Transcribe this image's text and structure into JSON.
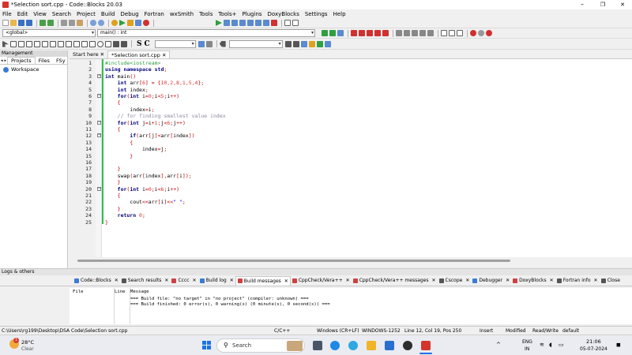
{
  "window": {
    "title": "*Selection sort.cpp - Code::Blocks 20.03",
    "min_glyph": "–",
    "max_glyph": "❐",
    "close_glyph": "✕"
  },
  "menu": [
    "File",
    "Edit",
    "View",
    "Search",
    "Project",
    "Build",
    "Debug",
    "Fortran",
    "wxSmith",
    "Tools",
    "Tools+",
    "Plugins",
    "DoxyBlocks",
    "Settings",
    "Help"
  ],
  "toolbar": {
    "scope_combo": "<global>",
    "function_combo": "main() : int",
    "letters": [
      "S",
      "C"
    ]
  },
  "management": {
    "header": "Management",
    "tabs": [
      "Projects",
      "Files",
      "FSy"
    ],
    "workspace": "Workspace"
  },
  "editor": {
    "tabs": [
      {
        "label": "Start here"
      },
      {
        "label": "*Selection sort.cpp"
      }
    ],
    "lines": [
      {
        "n": "1",
        "segs": [
          {
            "t": "#include<iostream>",
            "c": "#2f9e44"
          }
        ]
      },
      {
        "n": "2",
        "segs": [
          {
            "t": "using namespace ",
            "c": "#00007f",
            "b": 1
          },
          {
            "t": "std",
            "c": "#00007f",
            "b": 1
          },
          {
            "t": ";",
            "c": "#c00000"
          }
        ]
      },
      {
        "n": "3",
        "segs": [
          {
            "t": "int ",
            "c": "#00007f",
            "b": 1
          },
          {
            "t": "main",
            "c": "#000"
          },
          {
            "t": "()",
            "c": "#c00000"
          }
        ]
      },
      {
        "n": "4",
        "segs": [
          {
            "t": "    int ",
            "c": "#00007f",
            "b": 1
          },
          {
            "t": "arr",
            "c": "#000"
          },
          {
            "t": "[",
            "c": "#c00000"
          },
          {
            "t": "6",
            "c": "#e03030"
          },
          {
            "t": "] = {",
            "c": "#c00000"
          },
          {
            "t": "10,2,8,1,5,4",
            "c": "#e03030"
          },
          {
            "t": "};",
            "c": "#c00000"
          }
        ]
      },
      {
        "n": "5",
        "segs": [
          {
            "t": "    int ",
            "c": "#00007f",
            "b": 1
          },
          {
            "t": "index",
            "c": "#000"
          },
          {
            "t": ";",
            "c": "#c00000"
          }
        ]
      },
      {
        "n": "6",
        "segs": [
          {
            "t": "    for",
            "c": "#00007f",
            "b": 1
          },
          {
            "t": "(",
            "c": "#c00000"
          },
          {
            "t": "int ",
            "c": "#00007f",
            "b": 1
          },
          {
            "t": "i",
            "c": "#000"
          },
          {
            "t": "=",
            "c": "#c00000"
          },
          {
            "t": "0",
            "c": "#e03030"
          },
          {
            "t": ";",
            "c": "#c00000"
          },
          {
            "t": "i",
            "c": "#000"
          },
          {
            "t": "<",
            "c": "#c00000"
          },
          {
            "t": "5",
            "c": "#e03030"
          },
          {
            "t": ";",
            "c": "#c00000"
          },
          {
            "t": "i",
            "c": "#000"
          },
          {
            "t": "++)",
            "c": "#c00000"
          }
        ]
      },
      {
        "n": "7",
        "segs": [
          {
            "t": "    {",
            "c": "#c00000"
          }
        ]
      },
      {
        "n": "8",
        "segs": [
          {
            "t": "        index",
            "c": "#000"
          },
          {
            "t": "=",
            "c": "#c00000"
          },
          {
            "t": "i",
            "c": "#000"
          },
          {
            "t": ";",
            "c": "#c00000"
          }
        ]
      },
      {
        "n": "9",
        "segs": [
          {
            "t": "    // for finding smallest value index",
            "c": "#8a8aa0"
          }
        ]
      },
      {
        "n": "10",
        "segs": [
          {
            "t": "    for",
            "c": "#00007f",
            "b": 1
          },
          {
            "t": "(",
            "c": "#c00000"
          },
          {
            "t": "int ",
            "c": "#00007f",
            "b": 1
          },
          {
            "t": "j",
            "c": "#000"
          },
          {
            "t": "=",
            "c": "#c00000"
          },
          {
            "t": "i",
            "c": "#000"
          },
          {
            "t": "+",
            "c": "#c00000"
          },
          {
            "t": "1",
            "c": "#e03030"
          },
          {
            "t": ";",
            "c": "#c00000"
          },
          {
            "t": "j",
            "c": "#000"
          },
          {
            "t": "<",
            "c": "#c00000"
          },
          {
            "t": "6",
            "c": "#e03030"
          },
          {
            "t": ";",
            "c": "#c00000"
          },
          {
            "t": "j",
            "c": "#000"
          },
          {
            "t": "++)",
            "c": "#c00000"
          }
        ]
      },
      {
        "n": "11",
        "segs": [
          {
            "t": "    {",
            "c": "#c00000"
          }
        ]
      },
      {
        "n": "12",
        "segs": [
          {
            "t": "        if",
            "c": "#00007f",
            "b": 1
          },
          {
            "t": "(",
            "c": "#c00000"
          },
          {
            "t": "arr",
            "c": "#000"
          },
          {
            "t": "[",
            "c": "#c00000"
          },
          {
            "t": "j",
            "c": "#000"
          },
          {
            "t": "]<",
            "c": "#c00000"
          },
          {
            "t": "arr",
            "c": "#000"
          },
          {
            "t": "[",
            "c": "#c00000"
          },
          {
            "t": "index",
            "c": "#000"
          },
          {
            "t": "])",
            "c": "#c00000"
          }
        ]
      },
      {
        "n": "13",
        "segs": [
          {
            "t": "        {",
            "c": "#c00000"
          }
        ]
      },
      {
        "n": "14",
        "segs": [
          {
            "t": "            index",
            "c": "#000"
          },
          {
            "t": "=",
            "c": "#c00000"
          },
          {
            "t": "j",
            "c": "#000"
          },
          {
            "t": ";",
            "c": "#c00000"
          }
        ]
      },
      {
        "n": "15",
        "segs": [
          {
            "t": "        }",
            "c": "#c00000"
          }
        ]
      },
      {
        "n": "16",
        "segs": [
          {
            "t": "",
            "c": "#000"
          }
        ]
      },
      {
        "n": "17",
        "segs": [
          {
            "t": "    }",
            "c": "#c00000"
          }
        ]
      },
      {
        "n": "18",
        "segs": [
          {
            "t": "    swap",
            "c": "#000"
          },
          {
            "t": "(",
            "c": "#c00000"
          },
          {
            "t": "arr",
            "c": "#000"
          },
          {
            "t": "[",
            "c": "#c00000"
          },
          {
            "t": "index",
            "c": "#000"
          },
          {
            "t": "],",
            "c": "#c00000"
          },
          {
            "t": "arr",
            "c": "#000"
          },
          {
            "t": "[",
            "c": "#c00000"
          },
          {
            "t": "i",
            "c": "#000"
          },
          {
            "t": "]);",
            "c": "#c00000"
          }
        ]
      },
      {
        "n": "19",
        "segs": [
          {
            "t": "    }",
            "c": "#c00000"
          }
        ]
      },
      {
        "n": "20",
        "segs": [
          {
            "t": "    for",
            "c": "#00007f",
            "b": 1
          },
          {
            "t": "(",
            "c": "#c00000"
          },
          {
            "t": "int ",
            "c": "#00007f",
            "b": 1
          },
          {
            "t": "i",
            "c": "#000"
          },
          {
            "t": "=",
            "c": "#c00000"
          },
          {
            "t": "0",
            "c": "#e03030"
          },
          {
            "t": ";",
            "c": "#c00000"
          },
          {
            "t": "i",
            "c": "#000"
          },
          {
            "t": "<",
            "c": "#c00000"
          },
          {
            "t": "6",
            "c": "#e03030"
          },
          {
            "t": ";",
            "c": "#c00000"
          },
          {
            "t": "i",
            "c": "#000"
          },
          {
            "t": "++)",
            "c": "#c00000"
          }
        ]
      },
      {
        "n": "21",
        "segs": [
          {
            "t": "    {",
            "c": "#c00000"
          }
        ]
      },
      {
        "n": "22",
        "segs": [
          {
            "t": "        cout",
            "c": "#000"
          },
          {
            "t": "<<",
            "c": "#c00000"
          },
          {
            "t": "arr",
            "c": "#000"
          },
          {
            "t": "[",
            "c": "#c00000"
          },
          {
            "t": "i",
            "c": "#000"
          },
          {
            "t": "]<<",
            "c": "#c00000"
          },
          {
            "t": "\" \"",
            "c": "#0000ff"
          },
          {
            "t": ";",
            "c": "#c00000"
          }
        ]
      },
      {
        "n": "23",
        "segs": [
          {
            "t": "    }",
            "c": "#c00000"
          }
        ]
      },
      {
        "n": "24",
        "segs": [
          {
            "t": "    return ",
            "c": "#00007f",
            "b": 1
          },
          {
            "t": "0",
            "c": "#e03030"
          },
          {
            "t": ";",
            "c": "#c00000"
          }
        ]
      },
      {
        "n": "25",
        "segs": [
          {
            "t": "}",
            "c": "#c00000"
          }
        ]
      }
    ]
  },
  "logs": {
    "header": "Logs & others",
    "tabs": [
      {
        "label": "Code::Blocks",
        "color": "#3a7bd5"
      },
      {
        "label": "Search results",
        "color": "#555"
      },
      {
        "label": "Cccc",
        "color": "#d04040"
      },
      {
        "label": "Build log",
        "color": "#3a7bd5"
      },
      {
        "label": "Build messages",
        "color": "#d04040"
      },
      {
        "label": "CppCheck/Vera++",
        "color": "#d04040"
      },
      {
        "label": "CppCheck/Vera++ messages",
        "color": "#d04040"
      },
      {
        "label": "Cscope",
        "color": "#555"
      },
      {
        "label": "Debugger",
        "color": "#3a7bd5"
      },
      {
        "label": "DoxyBlocks",
        "color": "#d04040"
      },
      {
        "label": "Fortran info",
        "color": "#555"
      },
      {
        "label": "Close",
        "color": "#555"
      }
    ],
    "columns": [
      "File",
      "Line",
      "Message"
    ],
    "rows": [
      {
        "file": "",
        "line": "",
        "msg": "=== Build file: \"no target\" in \"no project\" (compiler: unknown) ==="
      },
      {
        "file": "",
        "line": "",
        "msg": "=== Build finished: 0 error(s), 0 warning(s) (0 minute(s), 0 second(s)) ==="
      }
    ]
  },
  "status": {
    "path": "C:\\Users\\rg199\\Desktop\\DSA Code\\Selection sort.cpp",
    "lang": "C/C++",
    "eol": "Windows (CR+LF)",
    "encoding": "WINDOWS-1252",
    "position": "Line 12, Col 19, Pos 250",
    "mode": "Insert",
    "modified": "Modified",
    "rw": "Read/Write",
    "profile": "default"
  },
  "taskbar": {
    "weather_temp": "28°C",
    "weather_desc": "Clear",
    "badge": "1",
    "search": "Search",
    "lang_top": "ENG",
    "lang_bottom": "IN",
    "time": "21:06",
    "date": "05-07-2024"
  }
}
